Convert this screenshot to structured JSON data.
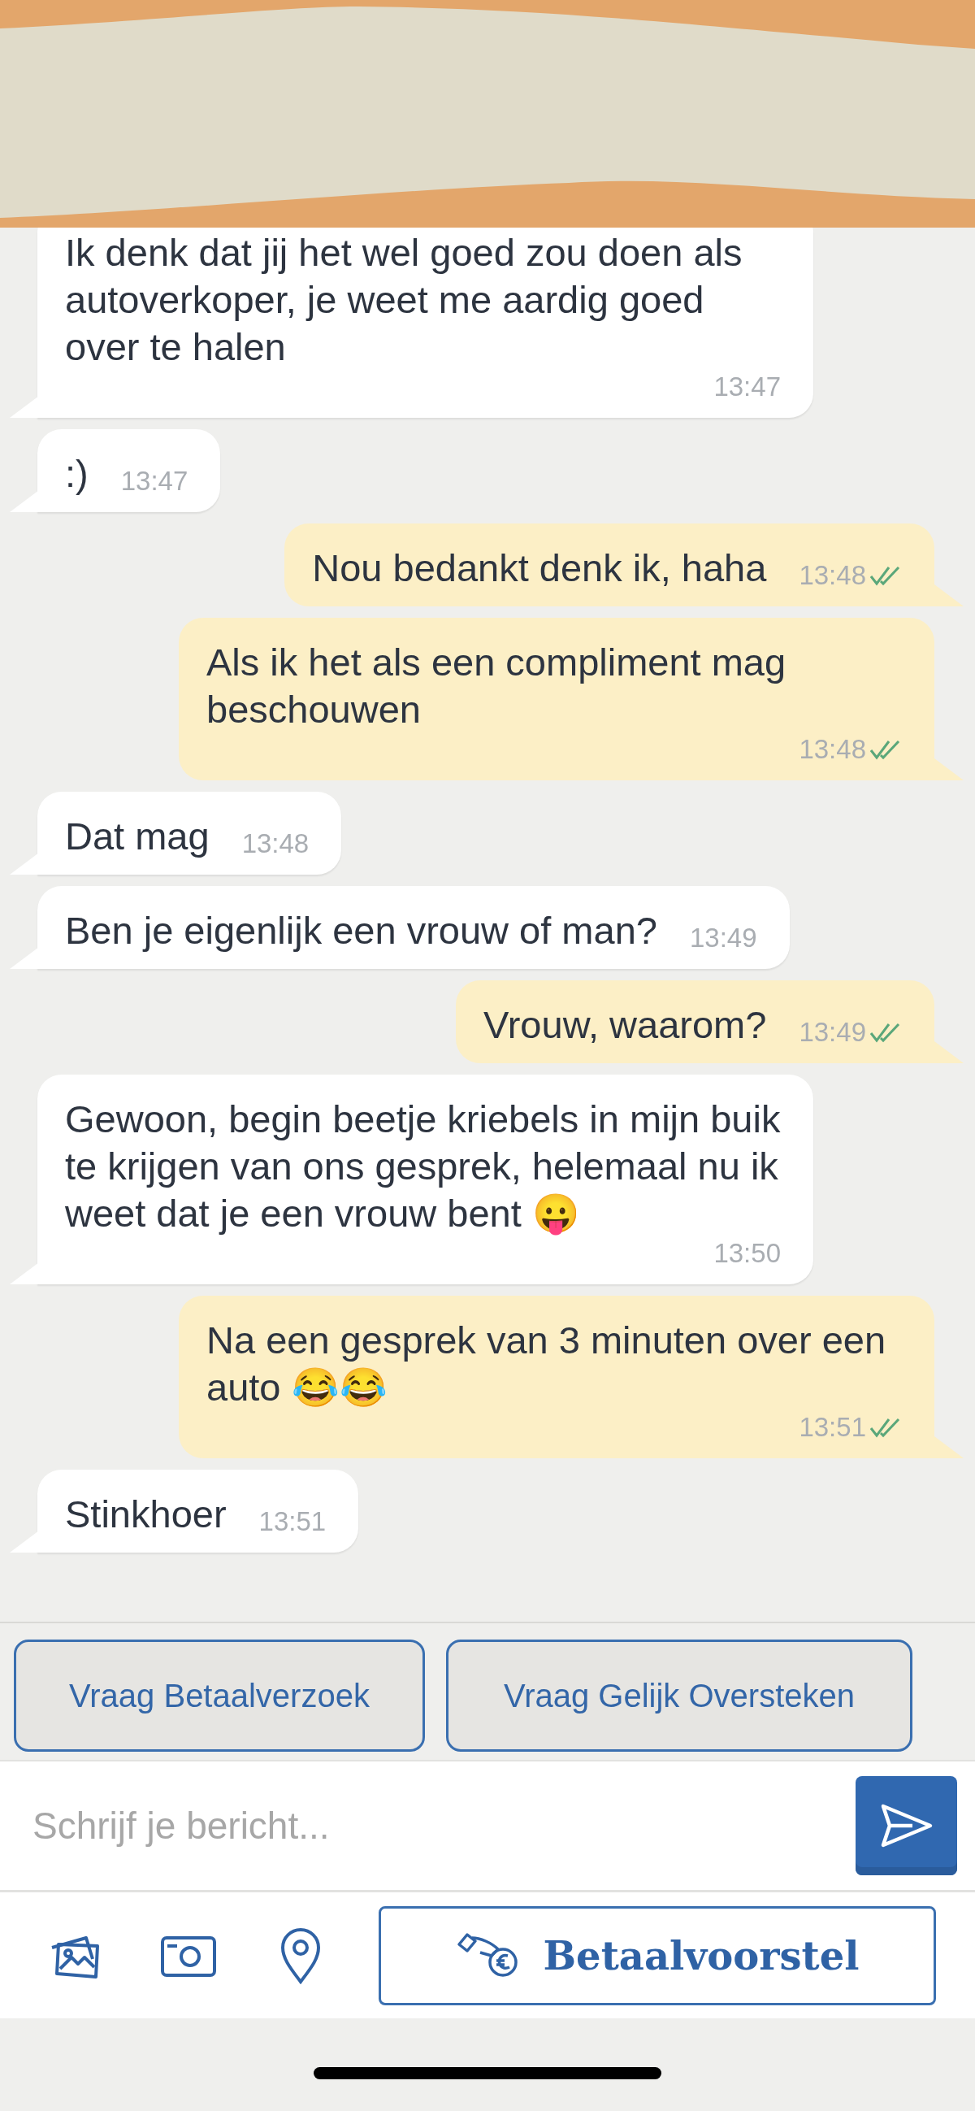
{
  "messages": [
    {
      "kind": "incoming",
      "text": "Ik denk dat jij het wel goed zou doen als autoverkoper, je weet me aardig goed over te halen",
      "time": "13:47"
    },
    {
      "kind": "incoming",
      "text": ":)",
      "time": "13:47"
    },
    {
      "kind": "outgoing",
      "text": "Nou bedankt denk ik, haha",
      "time": "13:48",
      "read": true
    },
    {
      "kind": "outgoing",
      "text": "Als ik het als een compliment mag beschouwen",
      "time": "13:48",
      "read": true
    },
    {
      "kind": "incoming",
      "text": "Dat mag",
      "time": "13:48"
    },
    {
      "kind": "incoming",
      "text": "Ben je eigenlijk een vrouw of man?",
      "time": "13:49"
    },
    {
      "kind": "outgoing",
      "text": "Vrouw, waarom?",
      "time": "13:49",
      "read": true
    },
    {
      "kind": "incoming",
      "text": "Gewoon, begin beetje kriebels in mijn buik te krijgen van ons gesprek, helemaal nu ik weet dat je een vrouw bent 😛",
      "time": "13:50"
    },
    {
      "kind": "outgoing",
      "text": "Na een gesprek van 3 minuten over een auto 😂😂",
      "time": "13:51",
      "read": true
    },
    {
      "kind": "incoming",
      "text": "Stinkhoer",
      "time": "13:51"
    }
  ],
  "quick_replies": [
    "Vraag Betaalverzoek",
    "Vraag Gelijk Oversteken"
  ],
  "composer": {
    "placeholder": "Schrijf je bericht..."
  },
  "payment_button": {
    "label": "Betaalvoorstel"
  }
}
